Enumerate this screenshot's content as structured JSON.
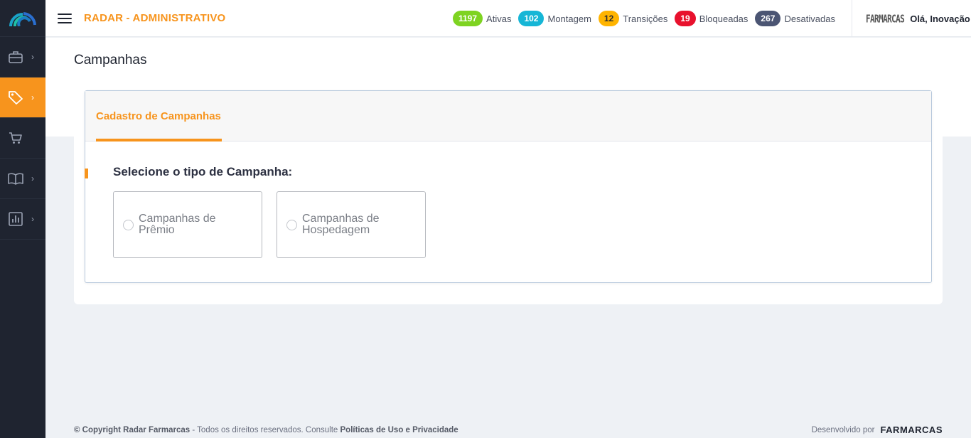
{
  "header": {
    "title": "RADAR - ADMINISTRATIVO",
    "user_logo": "FARMARCAS",
    "greeting": "Olá, Inovação"
  },
  "stats": [
    {
      "count": "1197",
      "label": "Ativas",
      "color": "#7ed321"
    },
    {
      "count": "102",
      "label": "Montagem",
      "color": "#16b6d6"
    },
    {
      "count": "12",
      "label": "Transições",
      "color": "#ffb400"
    },
    {
      "count": "19",
      "label": "Bloqueadas",
      "color": "#e8112d"
    },
    {
      "count": "267",
      "label": "Desativadas",
      "color": "#4b5573"
    }
  ],
  "sidebar": {
    "items": [
      {
        "icon": "briefcase-icon",
        "has_chevron": true
      },
      {
        "icon": "tag-icon",
        "has_chevron": true,
        "active": true
      },
      {
        "icon": "cart-icon",
        "has_chevron": false
      },
      {
        "icon": "book-icon",
        "has_chevron": true
      },
      {
        "icon": "bar-chart-icon",
        "has_chevron": true
      }
    ]
  },
  "page": {
    "title": "Campanhas",
    "tab_label": "Cadastro de Campanhas",
    "question": "Selecione o tipo de Campanha:",
    "options": [
      {
        "label": "Campanhas de Prêmio"
      },
      {
        "label": "Campanhas de Hospedagem"
      }
    ]
  },
  "footer": {
    "copyright": "© Copyright Radar Farmarcas",
    "rights": " - Todos os direitos reservados. Consulte ",
    "policies": "Políticas de Uso e Privacidade",
    "developed_by": "Desenvolvido por",
    "brand": "FARMARCAS"
  },
  "colors": {
    "accent": "#f7941d",
    "sidebar_bg": "#1f2430"
  }
}
